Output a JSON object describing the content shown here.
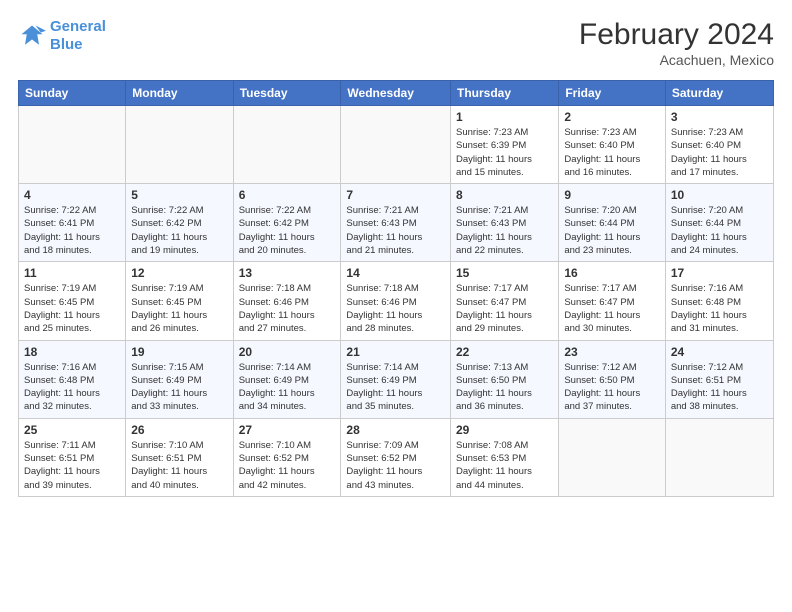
{
  "header": {
    "logo_line1": "General",
    "logo_line2": "Blue",
    "month_title": "February 2024",
    "location": "Acachuen, Mexico"
  },
  "weekdays": [
    "Sunday",
    "Monday",
    "Tuesday",
    "Wednesday",
    "Thursday",
    "Friday",
    "Saturday"
  ],
  "weeks": [
    [
      {
        "day": "",
        "info": ""
      },
      {
        "day": "",
        "info": ""
      },
      {
        "day": "",
        "info": ""
      },
      {
        "day": "",
        "info": ""
      },
      {
        "day": "1",
        "info": "Sunrise: 7:23 AM\nSunset: 6:39 PM\nDaylight: 11 hours\nand 15 minutes."
      },
      {
        "day": "2",
        "info": "Sunrise: 7:23 AM\nSunset: 6:40 PM\nDaylight: 11 hours\nand 16 minutes."
      },
      {
        "day": "3",
        "info": "Sunrise: 7:23 AM\nSunset: 6:40 PM\nDaylight: 11 hours\nand 17 minutes."
      }
    ],
    [
      {
        "day": "4",
        "info": "Sunrise: 7:22 AM\nSunset: 6:41 PM\nDaylight: 11 hours\nand 18 minutes."
      },
      {
        "day": "5",
        "info": "Sunrise: 7:22 AM\nSunset: 6:42 PM\nDaylight: 11 hours\nand 19 minutes."
      },
      {
        "day": "6",
        "info": "Sunrise: 7:22 AM\nSunset: 6:42 PM\nDaylight: 11 hours\nand 20 minutes."
      },
      {
        "day": "7",
        "info": "Sunrise: 7:21 AM\nSunset: 6:43 PM\nDaylight: 11 hours\nand 21 minutes."
      },
      {
        "day": "8",
        "info": "Sunrise: 7:21 AM\nSunset: 6:43 PM\nDaylight: 11 hours\nand 22 minutes."
      },
      {
        "day": "9",
        "info": "Sunrise: 7:20 AM\nSunset: 6:44 PM\nDaylight: 11 hours\nand 23 minutes."
      },
      {
        "day": "10",
        "info": "Sunrise: 7:20 AM\nSunset: 6:44 PM\nDaylight: 11 hours\nand 24 minutes."
      }
    ],
    [
      {
        "day": "11",
        "info": "Sunrise: 7:19 AM\nSunset: 6:45 PM\nDaylight: 11 hours\nand 25 minutes."
      },
      {
        "day": "12",
        "info": "Sunrise: 7:19 AM\nSunset: 6:45 PM\nDaylight: 11 hours\nand 26 minutes."
      },
      {
        "day": "13",
        "info": "Sunrise: 7:18 AM\nSunset: 6:46 PM\nDaylight: 11 hours\nand 27 minutes."
      },
      {
        "day": "14",
        "info": "Sunrise: 7:18 AM\nSunset: 6:46 PM\nDaylight: 11 hours\nand 28 minutes."
      },
      {
        "day": "15",
        "info": "Sunrise: 7:17 AM\nSunset: 6:47 PM\nDaylight: 11 hours\nand 29 minutes."
      },
      {
        "day": "16",
        "info": "Sunrise: 7:17 AM\nSunset: 6:47 PM\nDaylight: 11 hours\nand 30 minutes."
      },
      {
        "day": "17",
        "info": "Sunrise: 7:16 AM\nSunset: 6:48 PM\nDaylight: 11 hours\nand 31 minutes."
      }
    ],
    [
      {
        "day": "18",
        "info": "Sunrise: 7:16 AM\nSunset: 6:48 PM\nDaylight: 11 hours\nand 32 minutes."
      },
      {
        "day": "19",
        "info": "Sunrise: 7:15 AM\nSunset: 6:49 PM\nDaylight: 11 hours\nand 33 minutes."
      },
      {
        "day": "20",
        "info": "Sunrise: 7:14 AM\nSunset: 6:49 PM\nDaylight: 11 hours\nand 34 minutes."
      },
      {
        "day": "21",
        "info": "Sunrise: 7:14 AM\nSunset: 6:49 PM\nDaylight: 11 hours\nand 35 minutes."
      },
      {
        "day": "22",
        "info": "Sunrise: 7:13 AM\nSunset: 6:50 PM\nDaylight: 11 hours\nand 36 minutes."
      },
      {
        "day": "23",
        "info": "Sunrise: 7:12 AM\nSunset: 6:50 PM\nDaylight: 11 hours\nand 37 minutes."
      },
      {
        "day": "24",
        "info": "Sunrise: 7:12 AM\nSunset: 6:51 PM\nDaylight: 11 hours\nand 38 minutes."
      }
    ],
    [
      {
        "day": "25",
        "info": "Sunrise: 7:11 AM\nSunset: 6:51 PM\nDaylight: 11 hours\nand 39 minutes."
      },
      {
        "day": "26",
        "info": "Sunrise: 7:10 AM\nSunset: 6:51 PM\nDaylight: 11 hours\nand 40 minutes."
      },
      {
        "day": "27",
        "info": "Sunrise: 7:10 AM\nSunset: 6:52 PM\nDaylight: 11 hours\nand 42 minutes."
      },
      {
        "day": "28",
        "info": "Sunrise: 7:09 AM\nSunset: 6:52 PM\nDaylight: 11 hours\nand 43 minutes."
      },
      {
        "day": "29",
        "info": "Sunrise: 7:08 AM\nSunset: 6:53 PM\nDaylight: 11 hours\nand 44 minutes."
      },
      {
        "day": "",
        "info": ""
      },
      {
        "day": "",
        "info": ""
      }
    ]
  ]
}
